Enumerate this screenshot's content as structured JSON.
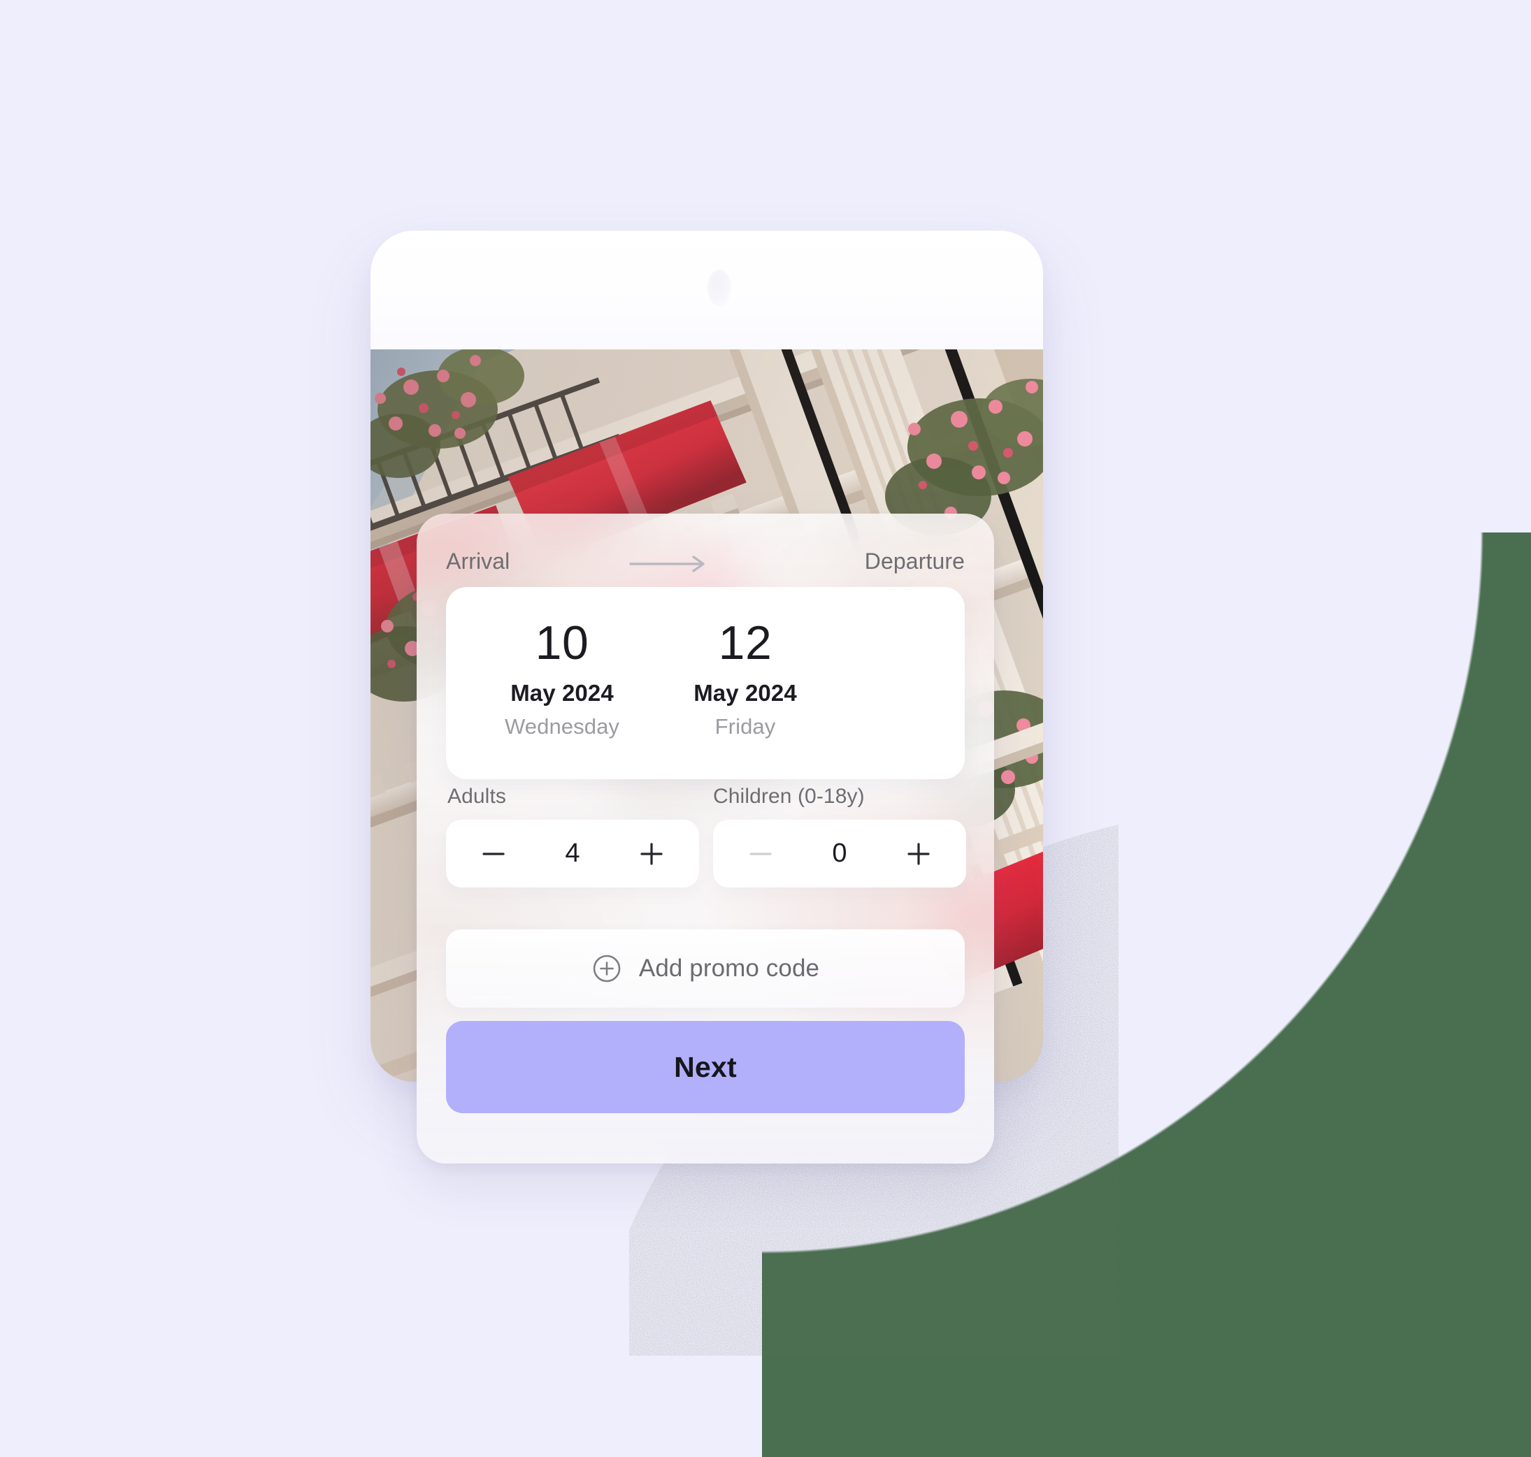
{
  "canvas": {
    "background_color": "#EFEEFC",
    "outside_circle_color": "#4A6F50"
  },
  "booking_sheet": {
    "header": {
      "arrival_label": "Arrival",
      "departure_label": "Departure",
      "arrow_icon": "arrow-right-icon"
    },
    "dates": {
      "arrival": {
        "day": "10",
        "month_year": "May 2024",
        "weekday": "Wednesday"
      },
      "departure": {
        "day": "12",
        "month_year": "May 2024",
        "weekday": "Friday"
      }
    },
    "guests": {
      "adults": {
        "label": "Adults",
        "value": "4",
        "decrement_icon": "minus-icon",
        "increment_icon": "plus-icon",
        "decrement_enabled": true
      },
      "children": {
        "label": "Children (0-18y)",
        "value": "0",
        "decrement_icon": "minus-icon",
        "increment_icon": "plus-icon",
        "decrement_enabled": false
      }
    },
    "promo": {
      "label": "Add promo code",
      "icon": "plus-circle-icon"
    },
    "next_button": {
      "label": "Next",
      "color": "#B2B0FB"
    }
  },
  "device": {
    "type": "phone-mockup",
    "body_color": "#FFFFFF",
    "photo_alt": "hotel-facade-photo"
  }
}
